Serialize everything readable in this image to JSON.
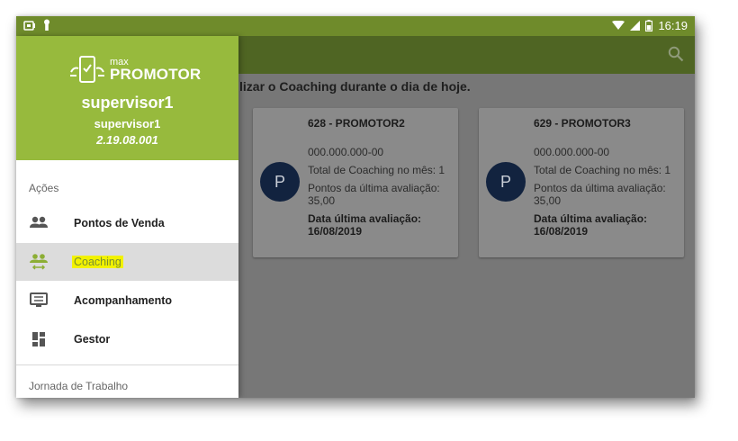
{
  "status_bar": {
    "time": "16:19"
  },
  "content": {
    "subtitle": "lizar o Coaching durante o dia de hoje.",
    "cards": [
      {
        "title": "628 - PROMOTOR2",
        "avatar_letter": "P",
        "id_number": "000.000.000-00",
        "coaching_total": "Total de Coaching no mês: 1",
        "last_score": "Pontos da última avaliação: 35,00",
        "last_date_label": "Data última avaliação:",
        "last_date": "16/08/2019"
      },
      {
        "title": "629 - PROMOTOR3",
        "avatar_letter": "P",
        "id_number": "000.000.000-00",
        "coaching_total": "Total de Coaching no mês: 1",
        "last_score": "Pontos da última avaliação: 35,00",
        "last_date_label": "Data última avaliação:",
        "last_date": "16/08/2019"
      }
    ]
  },
  "drawer": {
    "logo_small": "max",
    "logo_big": "PROMOTOR",
    "user_name": "supervisor1",
    "user_sub": "supervisor1",
    "version": "2.19.08.001",
    "section_actions": "Ações",
    "items": [
      {
        "label": "Pontos de Venda",
        "icon": "people-icon"
      },
      {
        "label": "Coaching",
        "icon": "coaching-icon",
        "active": true
      },
      {
        "label": "Acompanhamento",
        "icon": "monitor-icon"
      },
      {
        "label": "Gestor",
        "icon": "dashboard-icon"
      }
    ],
    "section_work": "Jornada de Trabalho"
  },
  "colors": {
    "status_bar": "#6f8b2b",
    "app_bar": "#4f6523",
    "drawer_header": "#97ba3d",
    "avatar": "#12233f",
    "highlight": "#f2f200"
  }
}
